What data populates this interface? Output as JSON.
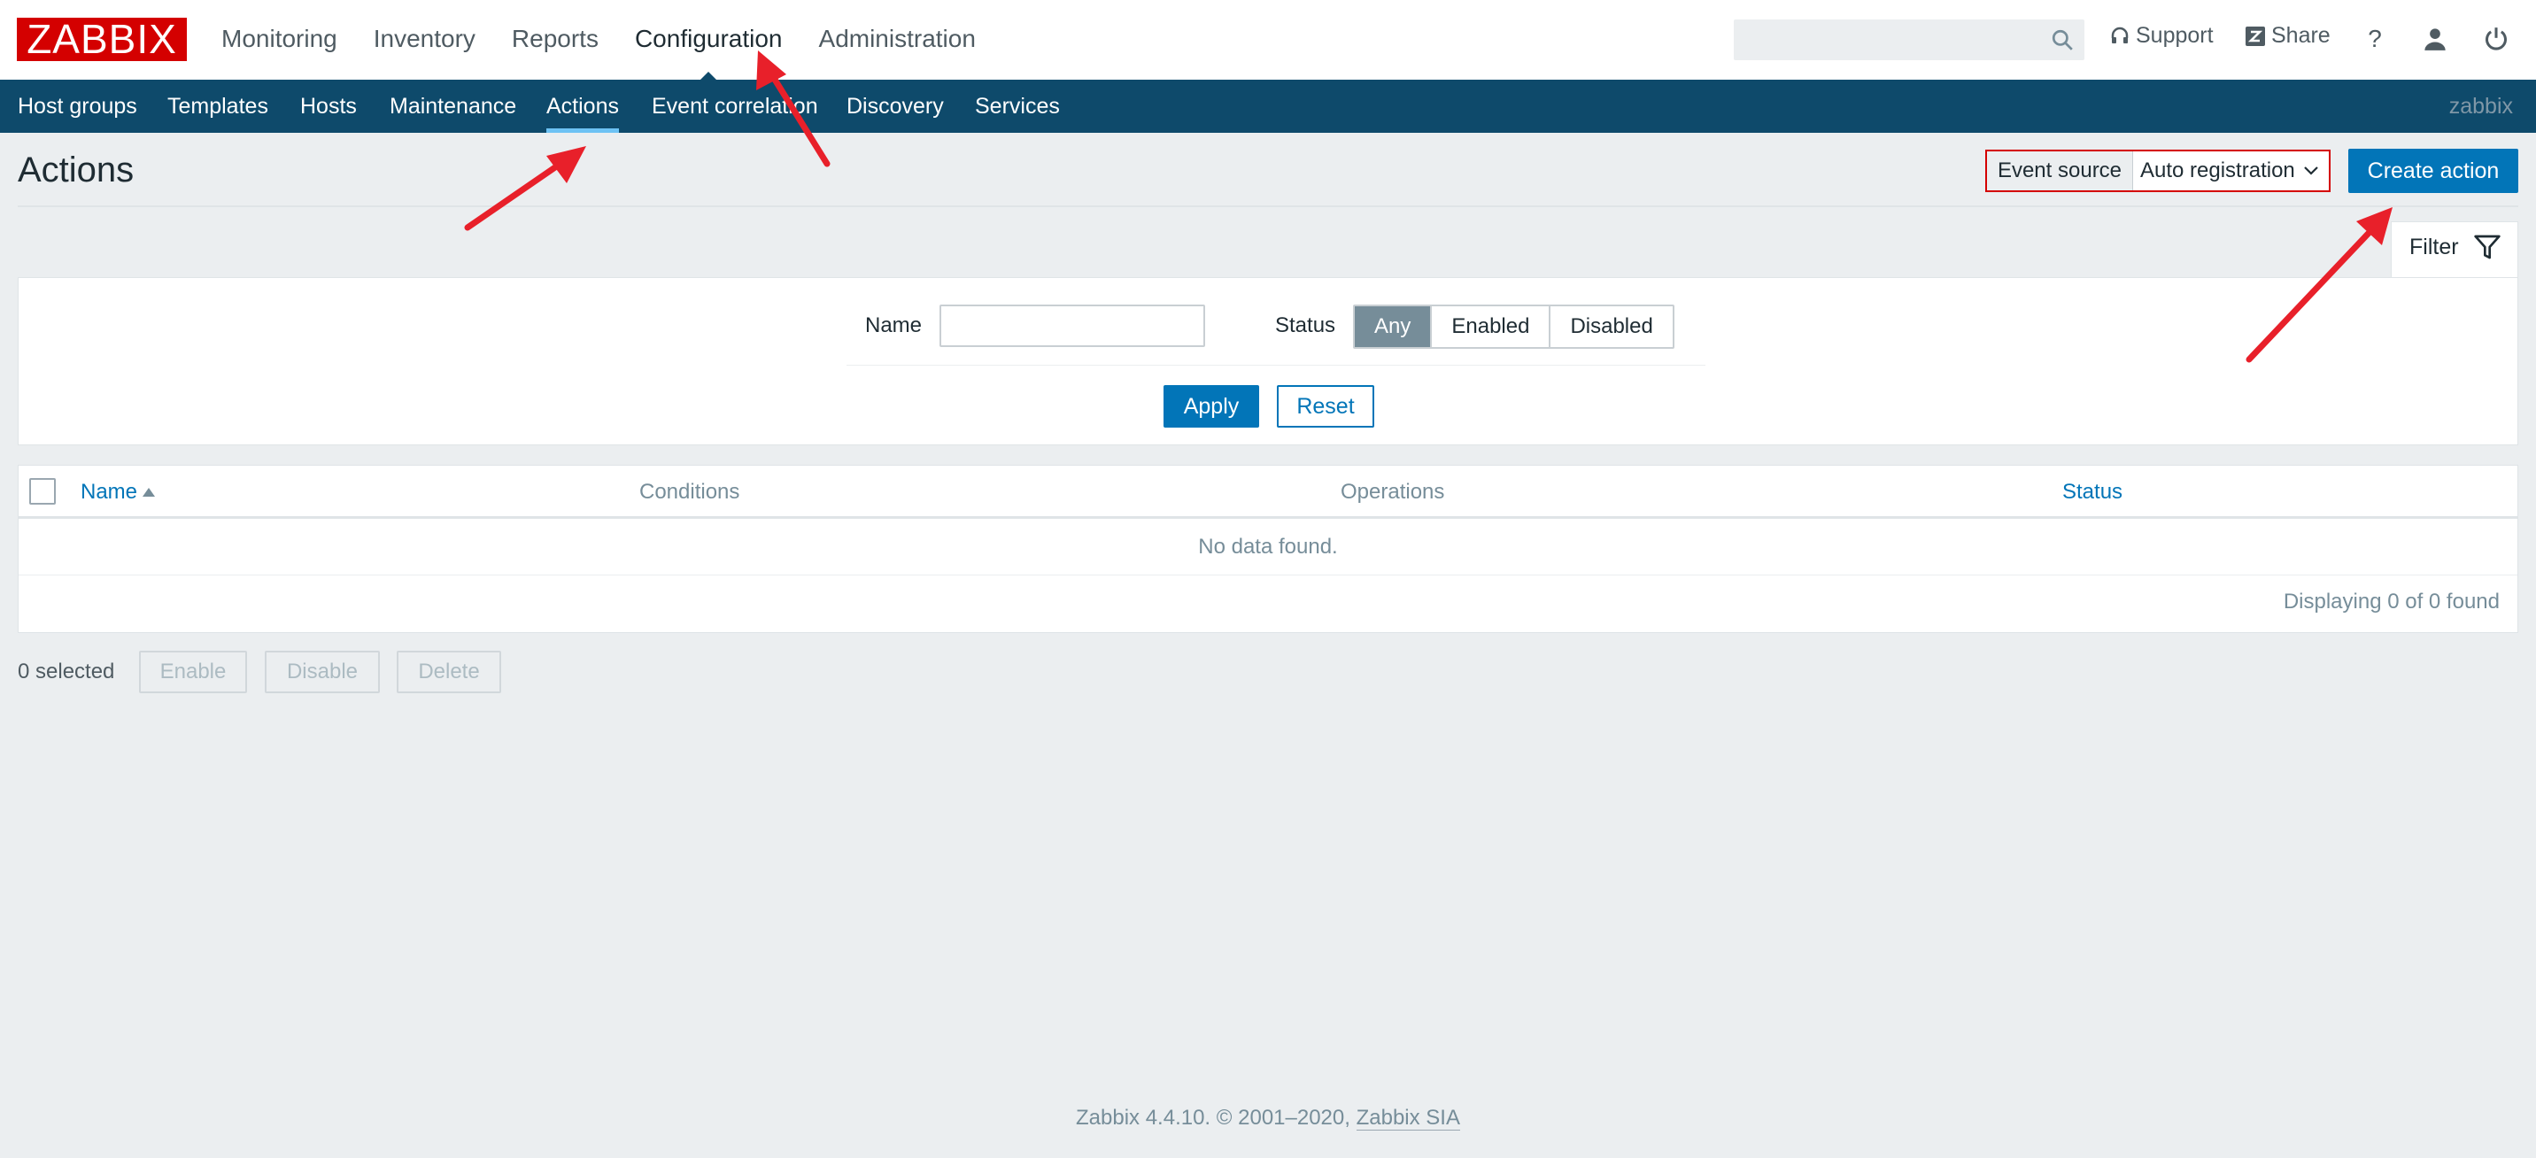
{
  "logo": {
    "text": "ZABBIX"
  },
  "main_menu": {
    "items": [
      {
        "label": "Monitoring"
      },
      {
        "label": "Inventory"
      },
      {
        "label": "Reports"
      },
      {
        "label": "Configuration",
        "selected": true
      },
      {
        "label": "Administration"
      }
    ]
  },
  "header_links": {
    "search_placeholder": "",
    "support": "Support",
    "share": "Share",
    "help": "?"
  },
  "sub_menu": {
    "items": [
      {
        "label": "Host groups"
      },
      {
        "label": "Templates"
      },
      {
        "label": "Hosts"
      },
      {
        "label": "Maintenance"
      },
      {
        "label": "Actions",
        "selected": true
      },
      {
        "label": "Event correlation"
      },
      {
        "label": "Discovery"
      },
      {
        "label": "Services"
      }
    ],
    "server_name": "zabbix"
  },
  "page": {
    "title": "Actions",
    "event_source_label": "Event source",
    "event_source_value": "Auto registration",
    "create_button": "Create action"
  },
  "filter": {
    "tab_label": "Filter",
    "name_label": "Name",
    "name_value": "",
    "status_label": "Status",
    "status_options": [
      "Any",
      "Enabled",
      "Disabled"
    ],
    "status_selected": "Any",
    "apply": "Apply",
    "reset": "Reset"
  },
  "table": {
    "columns": {
      "name": "Name",
      "conditions": "Conditions",
      "operations": "Operations",
      "status": "Status"
    },
    "empty_text": "No data found.",
    "paging": "Displaying 0 of 0 found"
  },
  "bulk_actions": {
    "selected_count": "0 selected",
    "enable": "Enable",
    "disable": "Disable",
    "delete": "Delete"
  },
  "footer": {
    "text": "Zabbix 4.4.10. © 2001–2020, ",
    "company": "Zabbix SIA"
  },
  "colors": {
    "brand_red": "#d40000",
    "submenu_bg": "#0e4a6b",
    "primary_blue": "#0275b8",
    "annotation_arrow": "#e8202a"
  }
}
